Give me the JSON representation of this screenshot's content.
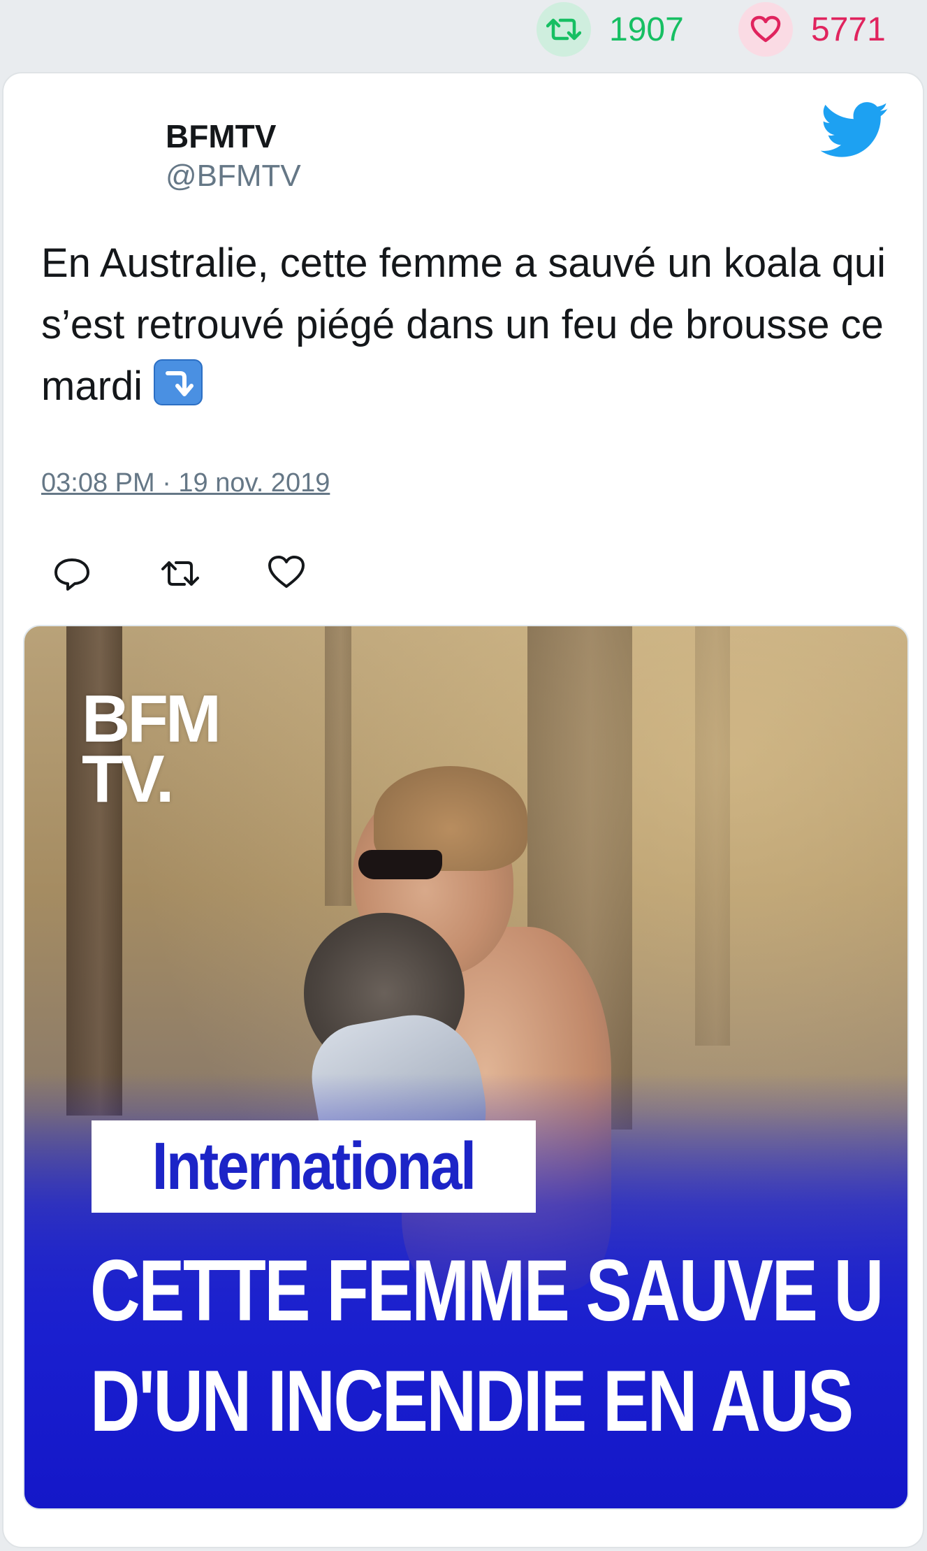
{
  "stats": {
    "retweets": "1907",
    "likes": "5771",
    "retweet_icon": "retweet-icon",
    "like_icon": "heart-icon",
    "retweet_color": "#17bf63",
    "like_color": "#e0245e"
  },
  "tweet": {
    "author_name": "BFMTV",
    "author_handle": "@BFMTV",
    "text": "En Australie, cette femme a sauvé un koala qui s’est retrouvé piégé dans un feu de brousse ce mardi",
    "emoji": "arrow-down-right-emoji",
    "timestamp": "03:08 PM · 19 nov. 2019",
    "brand_icon": "twitter-bird-icon",
    "brand_color": "#1da1f2"
  },
  "actions": [
    {
      "icon": "reply-icon"
    },
    {
      "icon": "retweet-icon"
    },
    {
      "icon": "heart-icon"
    }
  ],
  "media": {
    "logo_line1": "BFM",
    "logo_line2": "TV.",
    "category": "International",
    "headline_line1": "CETTE FEMME SAUVE U",
    "headline_line2": "D'UN INCENDIE EN AUS",
    "category_color": "#1c24c7"
  }
}
